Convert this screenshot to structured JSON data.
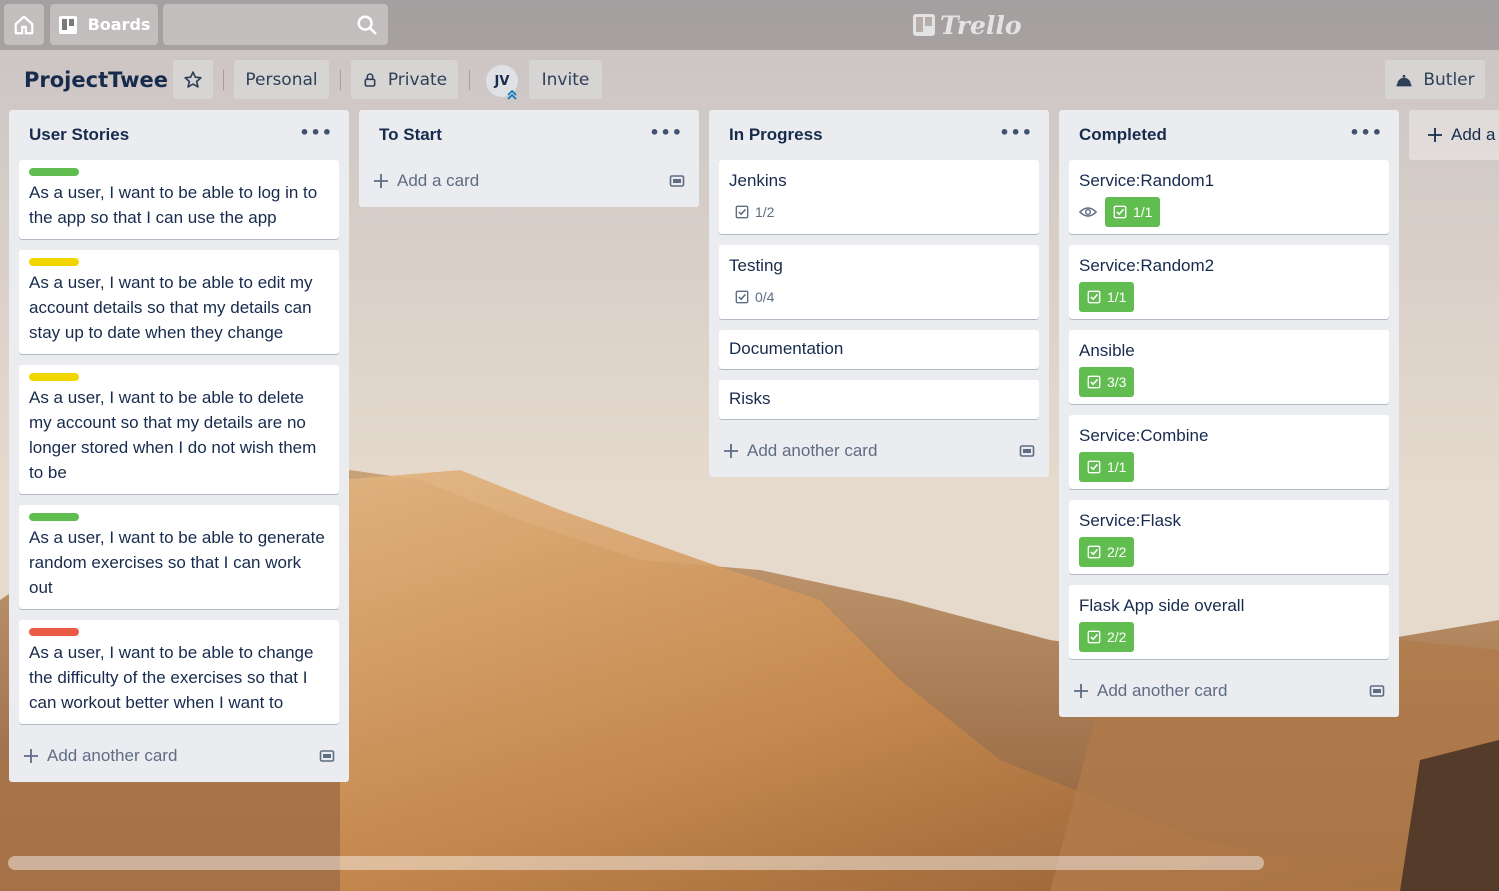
{
  "topbar": {
    "boards_label": "Boards",
    "search_value": "",
    "logo_text": "Trello"
  },
  "board": {
    "title": "ProjectTwee",
    "visibility_team": "Personal",
    "visibility_privacy": "Private",
    "member_initials": "JV",
    "invite_label": "Invite",
    "butler_label": "Butler"
  },
  "lists": [
    {
      "title": "User Stories",
      "cards": [
        {
          "label_color": "#61bd4f",
          "text": "As a user, I want to be able to log in to the app so that I can use the app"
        },
        {
          "label_color": "#f2d600",
          "text": "As a user, I want to be able to edit my account details so that my details can stay up to date when they change"
        },
        {
          "label_color": "#f2d600",
          "text": "As a user, I want to be able to delete my account so that my details are no longer stored when I do not wish them to be"
        },
        {
          "label_color": "#61bd4f",
          "text": "As a user, I want to be able to generate random exercises so that I can work out"
        },
        {
          "label_color": "#eb5a46",
          "text": "As a user, I want to be able to change the difficulty of the exercises so that I can workout better when I want to"
        }
      ],
      "add_label": "Add another card"
    },
    {
      "title": "To Start",
      "cards": [],
      "add_label": "Add a card"
    },
    {
      "title": "In Progress",
      "cards": [
        {
          "text": "Jenkins",
          "checklist": "1/2",
          "complete": false
        },
        {
          "text": "Testing",
          "checklist": "0/4",
          "complete": false
        },
        {
          "text": "Documentation"
        },
        {
          "text": "Risks"
        }
      ],
      "add_label": "Add another card"
    },
    {
      "title": "Completed",
      "cards": [
        {
          "text": "Service:Random1",
          "checklist": "1/1",
          "complete": true,
          "watching": true
        },
        {
          "text": "Service:Random2",
          "checklist": "1/1",
          "complete": true
        },
        {
          "text": "Ansible",
          "checklist": "3/3",
          "complete": true
        },
        {
          "text": "Service:Combine",
          "checklist": "1/1",
          "complete": true
        },
        {
          "text": "Service:Flask",
          "checklist": "2/2",
          "complete": true
        },
        {
          "text": "Flask App side overall",
          "checklist": "2/2",
          "complete": true
        }
      ],
      "add_label": "Add another card"
    }
  ],
  "add_list_label": "Add a",
  "colors": {
    "list_bg": "#ebecf0",
    "badge_complete": "#61bd4f",
    "text_primary": "#172b4d",
    "text_muted": "#5e6c84"
  },
  "icons": {
    "home": "home-icon",
    "boards": "boards-icon",
    "search": "search-icon",
    "star": "star-icon",
    "lock": "lock-icon",
    "butler": "butler-icon",
    "checklist": "checklist-icon",
    "eye": "eye-icon",
    "plus": "plus-icon",
    "template": "card-template-icon",
    "more": "more-dots-icon"
  }
}
